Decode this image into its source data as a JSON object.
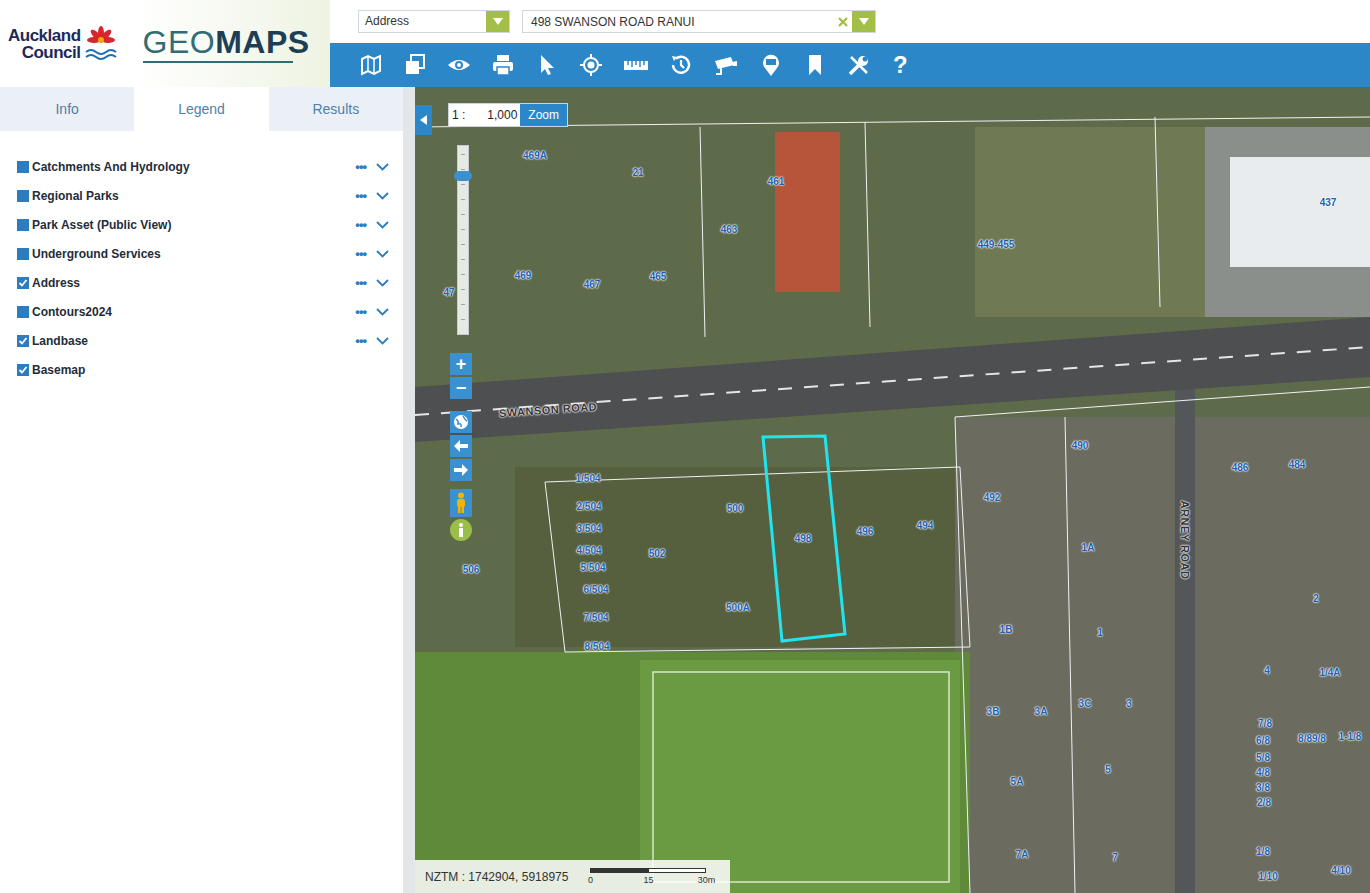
{
  "header": {
    "logo": {
      "line1": "Auckland",
      "line2": "Council",
      "geo": "GEO",
      "maps": "MAPS"
    },
    "search_type": "Address",
    "search_value": "498 SWANSON ROAD RANUI",
    "help": "?"
  },
  "tabs": [
    {
      "label": "Info",
      "selected": false
    },
    {
      "label": "Legend",
      "selected": true
    },
    {
      "label": "Results",
      "selected": false
    }
  ],
  "layers": [
    {
      "kind": "group",
      "label": "Catchments And Hydrology",
      "checked": false,
      "more": "•••"
    },
    {
      "kind": "group",
      "label": "Regional Parks",
      "checked": false,
      "more": "•••"
    },
    {
      "kind": "group",
      "label": "Park Asset (Public View)",
      "checked": false,
      "more": "•••"
    },
    {
      "kind": "group",
      "label": "Underground Services",
      "checked": false,
      "more": "•••"
    },
    {
      "kind": "group",
      "label": "Address",
      "checked": true,
      "more": "•••"
    },
    {
      "kind": "group",
      "label": "Contours2024",
      "checked": false,
      "more": "•••"
    },
    {
      "kind": "group",
      "label": "Landbase",
      "checked": true,
      "more": "•••"
    },
    {
      "kind": "basemap",
      "label": "Basemap",
      "checked": true
    }
  ],
  "map": {
    "scale_prefix": "1 :",
    "scale_value": "1,000",
    "zoom_button": "Zoom",
    "zoom_in": "+",
    "zoom_out": "−",
    "zoom_level": 0.84,
    "roads": [
      {
        "label": "SWANSON ROAD"
      },
      {
        "label": "ARNEY ROAD"
      }
    ],
    "parcels": [
      {
        "label": "469A",
        "selected": false
      },
      {
        "label": "21",
        "selected": false
      },
      {
        "label": "461",
        "selected": false
      },
      {
        "label": "463",
        "selected": false
      },
      {
        "label": "449-455",
        "selected": false
      },
      {
        "label": "437",
        "selected": false
      },
      {
        "label": "47",
        "selected": false
      },
      {
        "label": "469",
        "selected": false
      },
      {
        "label": "467",
        "selected": false
      },
      {
        "label": "465",
        "selected": false
      },
      {
        "label": "490",
        "selected": false
      },
      {
        "label": "486",
        "selected": false
      },
      {
        "label": "484",
        "selected": false
      },
      {
        "label": "1/504",
        "selected": false
      },
      {
        "label": "2/504",
        "selected": false
      },
      {
        "label": "3/504",
        "selected": false
      },
      {
        "label": "4/504",
        "selected": false
      },
      {
        "label": "5/504",
        "selected": false
      },
      {
        "label": "6/504",
        "selected": false
      },
      {
        "label": "7/504",
        "selected": false
      },
      {
        "label": "8/504",
        "selected": false
      },
      {
        "label": "500",
        "selected": false
      },
      {
        "label": "498",
        "selected": true
      },
      {
        "label": "496",
        "selected": false
      },
      {
        "label": "494",
        "selected": false
      },
      {
        "label": "492",
        "selected": false
      },
      {
        "label": "1A",
        "selected": false
      },
      {
        "label": "502",
        "selected": false
      },
      {
        "label": "506",
        "selected": false
      },
      {
        "label": "500A",
        "selected": false
      },
      {
        "label": "1B",
        "selected": false
      },
      {
        "label": "1",
        "selected": false
      },
      {
        "label": "2",
        "selected": false
      },
      {
        "label": "4",
        "selected": false
      },
      {
        "label": "1/4A",
        "selected": false
      },
      {
        "label": "3B",
        "selected": false
      },
      {
        "label": "3A",
        "selected": false
      },
      {
        "label": "3C",
        "selected": false
      },
      {
        "label": "3",
        "selected": false
      },
      {
        "label": "7/8",
        "selected": false
      },
      {
        "label": "6/8",
        "selected": false
      },
      {
        "label": "5/8",
        "selected": false
      },
      {
        "label": "4/8",
        "selected": false
      },
      {
        "label": "3/8",
        "selected": false
      },
      {
        "label": "2/8",
        "selected": false
      },
      {
        "label": "8/89/8",
        "selected": false
      },
      {
        "label": "1-1/8",
        "selected": false
      },
      {
        "label": "5A",
        "selected": false
      },
      {
        "label": "5",
        "selected": false
      },
      {
        "label": "7A",
        "selected": false
      },
      {
        "label": "7",
        "selected": false
      },
      {
        "label": "1/8",
        "selected": false
      },
      {
        "label": "4/10",
        "selected": false
      },
      {
        "label": "1/10",
        "selected": false
      }
    ]
  },
  "status": {
    "coords": "NZTM : 1742904, 5918975",
    "scale_ticks": [
      "0",
      "15",
      "30m"
    ]
  }
}
